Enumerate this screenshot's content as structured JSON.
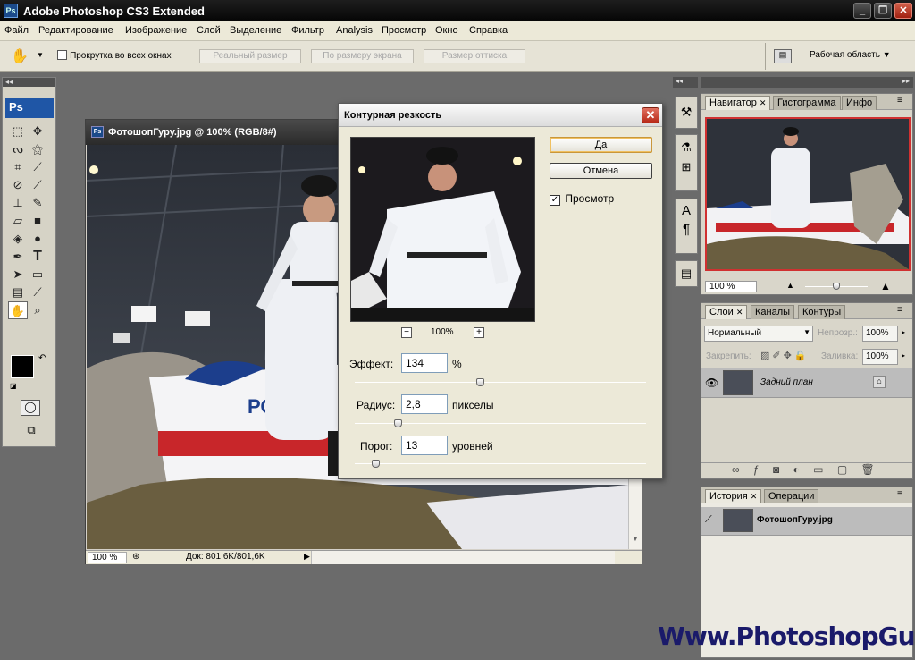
{
  "app": {
    "title": "Adobe Photoshop CS3 Extended",
    "logo": "Ps"
  },
  "window_controls": {
    "minimize": "_",
    "restore": "❐",
    "close": "✕"
  },
  "menu": [
    "Файл",
    "Редактирование",
    "Изображение",
    "Слой",
    "Выделение",
    "Фильтр",
    "Analysis",
    "Просмотр",
    "Окно",
    "Справка"
  ],
  "options": {
    "scroll_all": "Прокрутка во всех окнах",
    "actual_pixels": "Реальный размер",
    "fit_screen": "По размеру экрана",
    "print_size": "Размер оттиска",
    "workspace": "Рабочая область"
  },
  "toolbox": {
    "logo": "Ps"
  },
  "document": {
    "title": "ФотошопГуру.jpg @ 100% (RGB/8#)",
    "zoom": "100 %",
    "doc_size": "Док: 801,6K/801,6K",
    "plane_text": "РОСТО"
  },
  "dialog": {
    "title": "Контурная резкость",
    "ok": "Да",
    "cancel": "Отмена",
    "preview_label": "Просмотр",
    "preview_checked": true,
    "zoom": "100%",
    "amount_label": "Эффект:",
    "amount_value": "134",
    "amount_unit": "%",
    "amount_pct": 0.43,
    "radius_label": "Радиус:",
    "radius_value": "2,8",
    "radius_unit": "пикселы",
    "threshold_label": "Порог:",
    "threshold_value": "13",
    "threshold_unit": "уровней"
  },
  "navigator": {
    "tabs": [
      "Навигатор",
      "Гистограмма",
      "Инфо"
    ],
    "zoom": "100 %"
  },
  "layers": {
    "tabs": [
      "Слои",
      "Каналы",
      "Контуры"
    ],
    "blend_mode": "Нормальный",
    "opacity_label": "Непрозр.:",
    "opacity_value": "100%",
    "lock_label": "Закрепить:",
    "fill_label": "Заливка:",
    "fill_value": "100%",
    "layer_name": "Задний план"
  },
  "history": {
    "tabs": [
      "История",
      "Операции"
    ],
    "item": "ФотошопГуру.jpg"
  },
  "watermark": "Www.PhotoshopGu.ru",
  "colors": {
    "accent": "#1f56a6",
    "dialog_bg": "#ece9d8",
    "close_red": "#c0301e"
  }
}
